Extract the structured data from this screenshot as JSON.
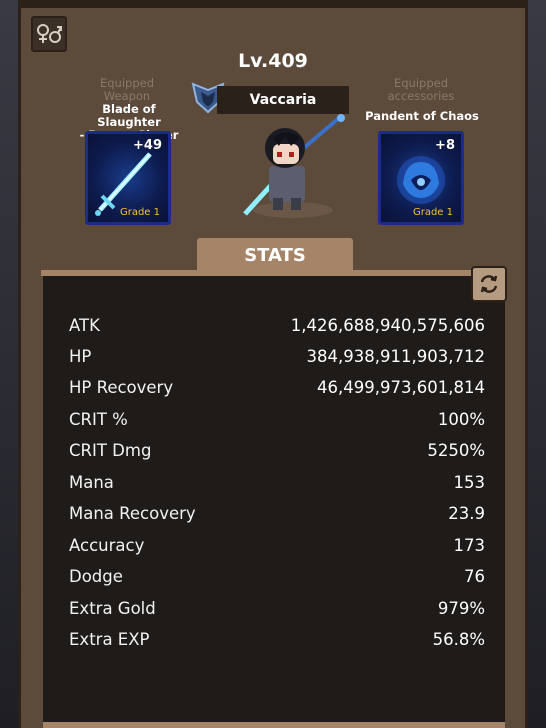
{
  "character": {
    "level": "Lv.409",
    "name": "Vaccaria"
  },
  "weapon_slot": {
    "caption": "Equipped Weapon",
    "item_name_line1": "Blade of Slaughter",
    "item_name_line2": "- Demon Slayer",
    "enhance": "+49",
    "grade": "Grade 1"
  },
  "accessory_slot": {
    "caption_line1": "Equipped",
    "caption_line2": "accessories",
    "item_name": "Pandent of Chaos",
    "enhance": "+8",
    "grade": "Grade 1"
  },
  "stats_tab": {
    "label": "STATS"
  },
  "stats": [
    {
      "label": "ATK",
      "value": "1,426,688,940,575,606"
    },
    {
      "label": "HP",
      "value": "384,938,911,903,712"
    },
    {
      "label": "HP Recovery",
      "value": "46,499,973,601,814"
    },
    {
      "label": "CRIT %",
      "value": "100%"
    },
    {
      "label": "CRIT Dmg",
      "value": "5250%"
    },
    {
      "label": "Mana",
      "value": "153"
    },
    {
      "label": "Mana Recovery",
      "value": "23.9"
    },
    {
      "label": "Accuracy",
      "value": "173"
    },
    {
      "label": "Dodge",
      "value": "76"
    },
    {
      "label": "Extra Gold",
      "value": "979%"
    },
    {
      "label": "Extra EXP",
      "value": "56.8%"
    }
  ],
  "icons": {
    "gender": "gender-icon",
    "refresh": "refresh-icon",
    "emblem": "emblem-icon"
  }
}
